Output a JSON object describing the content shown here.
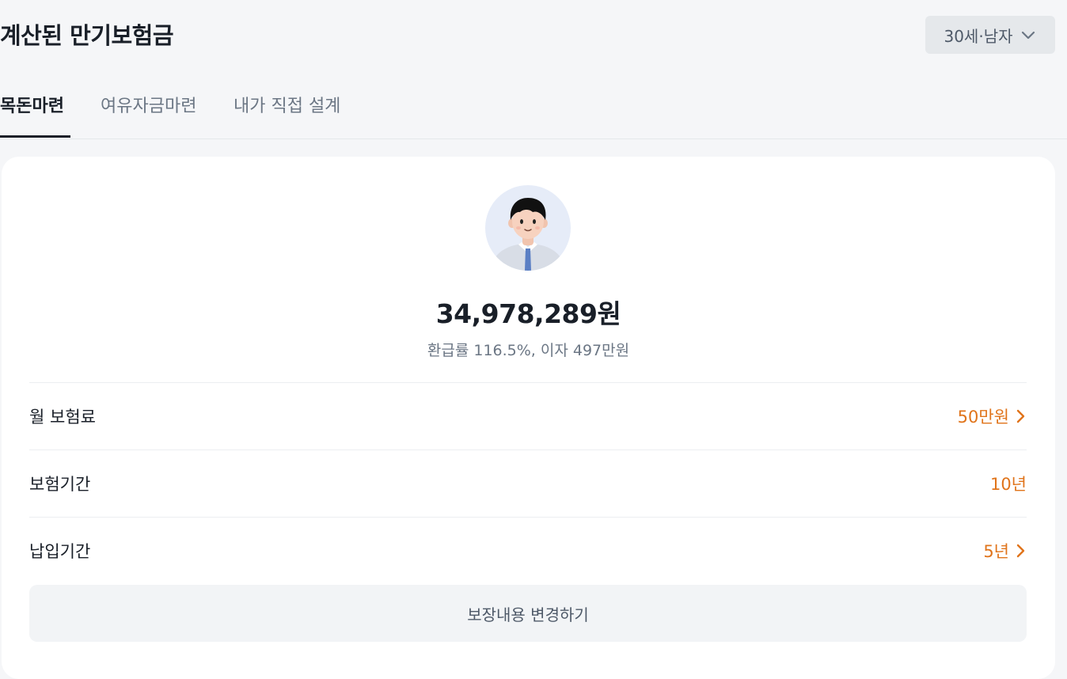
{
  "header": {
    "title": "계산된 만기보험금",
    "profile_select": {
      "value": "30세·남자",
      "icon": "chevron-down-icon"
    }
  },
  "tabs": [
    {
      "label": "목돈마련",
      "active": true
    },
    {
      "label": "여유자금마련",
      "active": false
    },
    {
      "label": "내가 직접 설계",
      "active": false
    }
  ],
  "summary": {
    "avatar_icon": "person-avatar-icon",
    "amount": "34,978,289원",
    "detail": "환급률 116.5%, 이자 497만원"
  },
  "rows": [
    {
      "label": "월 보험료",
      "value": "50만원",
      "has_chevron": true
    },
    {
      "label": "보험기간",
      "value": "10년",
      "has_chevron": false
    },
    {
      "label": "납입기간",
      "value": "5년",
      "has_chevron": true
    }
  ],
  "change_button": {
    "label": "보장내용 변경하기"
  },
  "colors": {
    "background": "#f5f6f8",
    "card": "#ffffff",
    "accent": "#e0741b",
    "text_primary": "#191f28",
    "text_secondary": "#6b7684",
    "button_bg": "#f2f4f6"
  }
}
